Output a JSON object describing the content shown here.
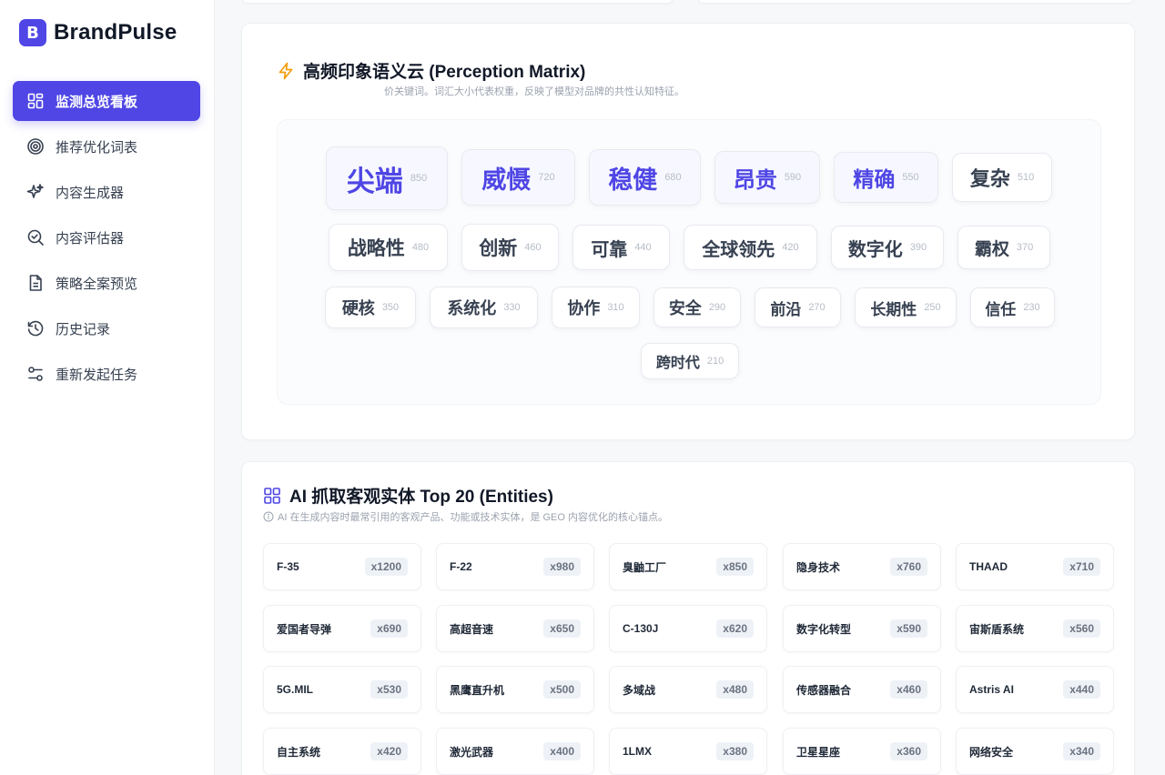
{
  "brand": {
    "logo_letter": "B",
    "name": "BrandPulse",
    "accent": "#4f46e5"
  },
  "sidebar": {
    "items": [
      {
        "label": "监测总览看板",
        "icon": "dashboard-grid-icon",
        "active": true
      },
      {
        "label": "推荐优化词表",
        "icon": "target-icon",
        "active": false
      },
      {
        "label": "内容生成器",
        "icon": "sparkles-icon",
        "active": false
      },
      {
        "label": "内容评估器",
        "icon": "search-check-icon",
        "active": false
      },
      {
        "label": "策略全案预览",
        "icon": "document-icon",
        "active": false
      },
      {
        "label": "历史记录",
        "icon": "history-icon",
        "active": false
      },
      {
        "label": "重新发起任务",
        "icon": "sliders-icon",
        "active": false
      }
    ]
  },
  "perception": {
    "title": "高频印象语义云 (Perception Matrix)",
    "title_icon": "lightning-icon",
    "subtitle": "价关键词。词汇大小代表权重，反映了模型对品牌的共性认知特征。",
    "tags": [
      {
        "word": "尖端",
        "count": "850"
      },
      {
        "word": "威慑",
        "count": "720"
      },
      {
        "word": "稳健",
        "count": "680"
      },
      {
        "word": "昂贵",
        "count": "590"
      },
      {
        "word": "精确",
        "count": "550"
      },
      {
        "word": "复杂",
        "count": "510"
      },
      {
        "word": "战略性",
        "count": "480"
      },
      {
        "word": "创新",
        "count": "460"
      },
      {
        "word": "可靠",
        "count": "440"
      },
      {
        "word": "全球领先",
        "count": "420"
      },
      {
        "word": "数字化",
        "count": "390"
      },
      {
        "word": "霸权",
        "count": "370"
      },
      {
        "word": "硬核",
        "count": "350"
      },
      {
        "word": "系统化",
        "count": "330"
      },
      {
        "word": "协作",
        "count": "310"
      },
      {
        "word": "安全",
        "count": "290"
      },
      {
        "word": "前沿",
        "count": "270"
      },
      {
        "word": "长期性",
        "count": "250"
      },
      {
        "word": "信任",
        "count": "230"
      },
      {
        "word": "跨时代",
        "count": "210"
      }
    ]
  },
  "entities": {
    "title": "AI 抓取客观实体 Top 20 (Entities)",
    "title_icon": "grid-icon",
    "subtitle": "AI 在生成内容时最常引用的客观产品、功能或技术实体，是 GEO 内容优化的核心锚点。",
    "items": [
      {
        "name": "F-35",
        "count": "x1200"
      },
      {
        "name": "F-22",
        "count": "x980"
      },
      {
        "name": "臭鼬工厂",
        "count": "x850"
      },
      {
        "name": "隐身技术",
        "count": "x760"
      },
      {
        "name": "THAAD",
        "count": "x710"
      },
      {
        "name": "爱国者导弹",
        "count": "x690"
      },
      {
        "name": "高超音速",
        "count": "x650"
      },
      {
        "name": "C-130J",
        "count": "x620"
      },
      {
        "name": "数字化转型",
        "count": "x590"
      },
      {
        "name": "宙斯盾系统",
        "count": "x560"
      },
      {
        "name": "5G.MIL",
        "count": "x530"
      },
      {
        "name": "黑鹰直升机",
        "count": "x500"
      },
      {
        "name": "多域战",
        "count": "x480"
      },
      {
        "name": "传感器融合",
        "count": "x460"
      },
      {
        "name": "Astris AI",
        "count": "x440"
      },
      {
        "name": "自主系统",
        "count": "x420"
      },
      {
        "name": "激光武器",
        "count": "x400"
      },
      {
        "name": "1LMX",
        "count": "x380"
      },
      {
        "name": "卫星星座",
        "count": "x360"
      },
      {
        "name": "网络安全",
        "count": "x340"
      }
    ]
  }
}
